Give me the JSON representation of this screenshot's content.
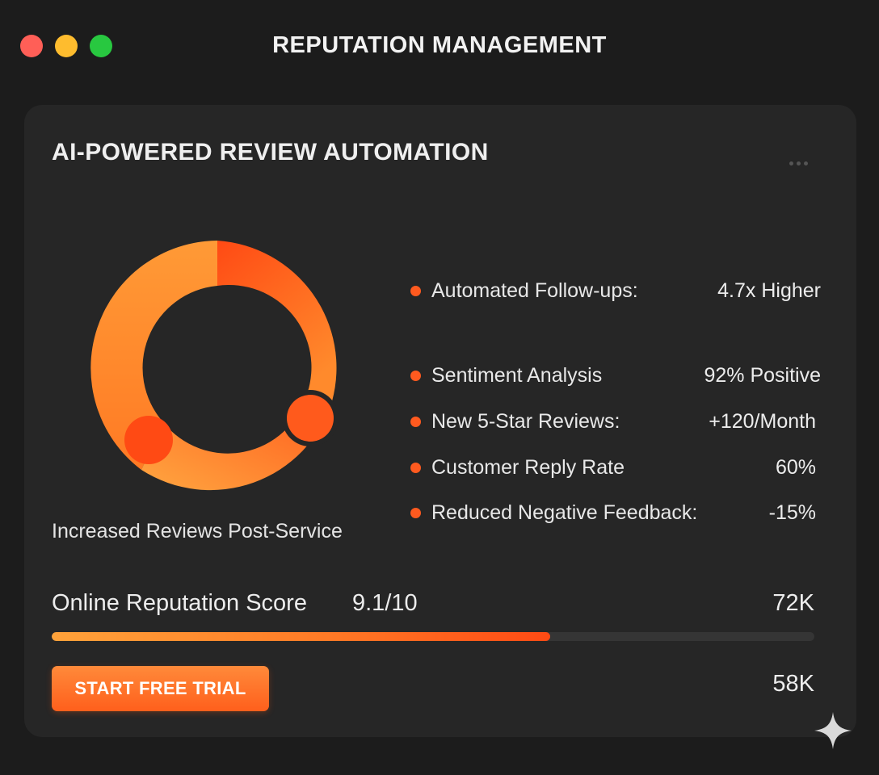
{
  "window": {
    "title": "REPUTATION MANAGEMENT",
    "controls": [
      "close",
      "minimize",
      "maximize"
    ]
  },
  "card": {
    "title": "AI-POWERED REVIEW AUTOMATION",
    "menu_icon": "more-horizontal-icon",
    "donut": {
      "caption": "Increased Reviews Post-Service",
      "colors": [
        "#ff4a14",
        "#ff8a2e",
        "#ffa83f"
      ]
    },
    "metrics": [
      {
        "label": "Automated Follow-ups:",
        "value": "4.7x Higher"
      },
      {
        "label": "Sentiment Analysis",
        "value": "92% Positive"
      },
      {
        "label": "New 5-Star Reviews:",
        "value": "+120/Month"
      },
      {
        "label": "Customer Reply Rate",
        "value": "60%"
      },
      {
        "label": "Reduced Negative Feedback:",
        "value": "-15%"
      }
    ],
    "score": {
      "label": "Online Reputation Score",
      "value": "9.1/10",
      "count_top": "72K",
      "progress_fraction": 0.654,
      "count_bottom": "58K"
    },
    "cta_label": "START FREE TRIAL"
  },
  "colors": {
    "accent": "#ff5a1f",
    "background": "#1c1c1c",
    "card": "#262626"
  },
  "decor": {
    "corner_icon": "sparkle-icon"
  }
}
